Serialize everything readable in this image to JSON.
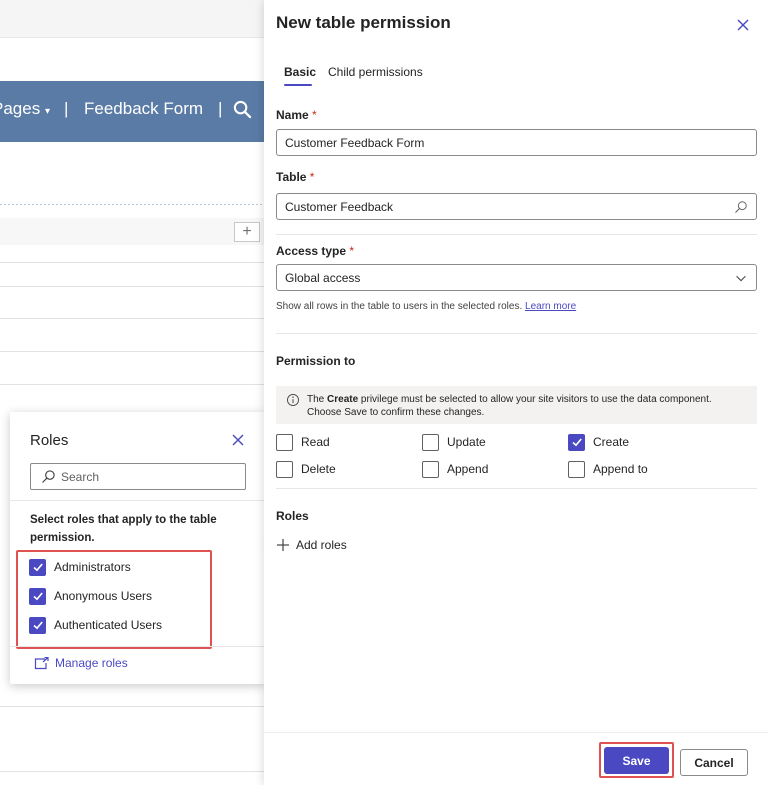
{
  "background": {
    "nav_pages": "Pages",
    "nav_pages_caret": "▾",
    "nav_sep": "|",
    "nav_form": "Feedback Form",
    "add_symbol": "+"
  },
  "roles_flyout": {
    "title": "Roles",
    "search_placeholder": "Search",
    "description": "Select roles that apply to the table permission.",
    "roles": [
      {
        "label": "Administrators",
        "checked": true
      },
      {
        "label": "Anonymous Users",
        "checked": true
      },
      {
        "label": "Authenticated Users",
        "checked": true
      }
    ],
    "manage_roles": "Manage roles"
  },
  "panel": {
    "title": "New table permission",
    "tabs": [
      {
        "label": "Basic",
        "active": true
      },
      {
        "label": "Child permissions",
        "active": false
      }
    ],
    "name": {
      "label": "Name",
      "required": "*",
      "value": "Customer Feedback Form"
    },
    "table": {
      "label": "Table",
      "required": "*",
      "value": "Customer Feedback"
    },
    "access_type": {
      "label": "Access type",
      "required": "*",
      "value": "Global access",
      "help_text": "Show all rows in the table to users in the selected roles.",
      "help_link": "Learn more"
    },
    "permission_to": {
      "label": "Permission to",
      "info_pre": "The ",
      "info_bold": "Create",
      "info_post": " privilege must be selected to allow your site visitors to use the data component. Choose Save to confirm these changes.",
      "options": [
        {
          "label": "Read",
          "checked": false
        },
        {
          "label": "Update",
          "checked": false
        },
        {
          "label": "Create",
          "checked": true
        },
        {
          "label": "Delete",
          "checked": false
        },
        {
          "label": "Append",
          "checked": false
        },
        {
          "label": "Append to",
          "checked": false
        }
      ]
    },
    "roles": {
      "label": "Roles",
      "add_label": "Add roles"
    },
    "footer": {
      "save": "Save",
      "cancel": "Cancel"
    }
  },
  "colors": {
    "accent": "#4a49c2",
    "highlight": "#e05252",
    "nav_bar": "#5a7ba6",
    "required": "#c42b1c"
  },
  "icons": [
    "search-icon",
    "close-icon",
    "chevron-down-icon",
    "info-icon",
    "checkmark-icon",
    "plus-icon",
    "manage-roles-icon"
  ]
}
